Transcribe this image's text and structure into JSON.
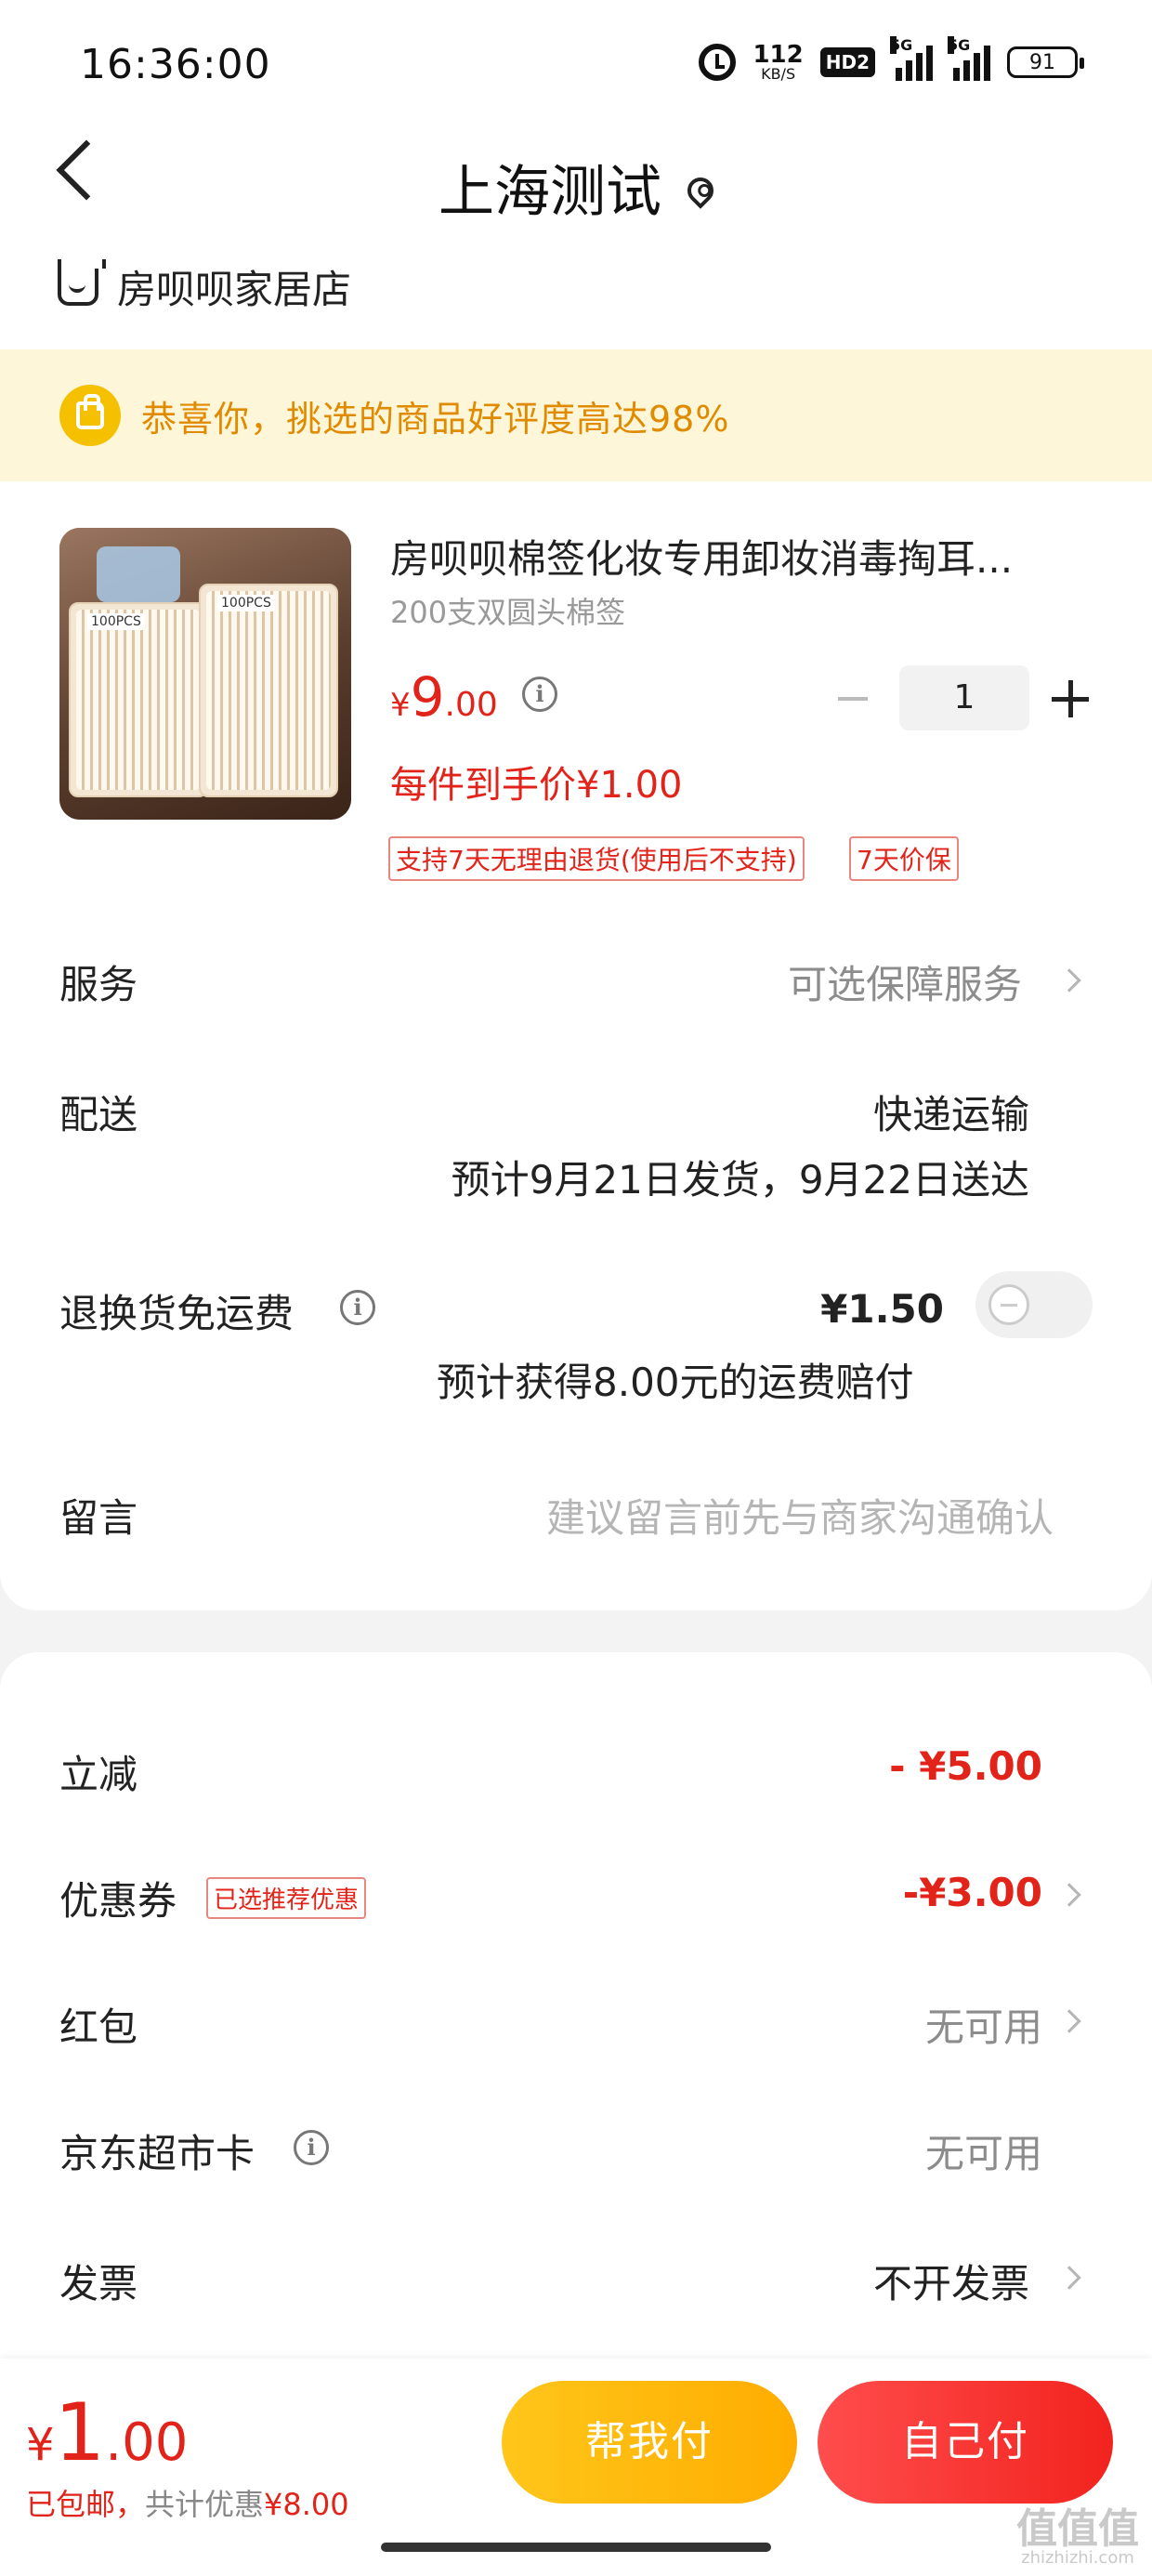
{
  "status_bar": {
    "time": "16:36:00",
    "net_speed_value": "112",
    "net_speed_unit": "KB/S",
    "hd_label": "HD2",
    "signal1_label": "5G",
    "signal2_label": "5G",
    "battery": "91"
  },
  "nav": {
    "title": "上海测试",
    "shop_name": "房呗呗家居店"
  },
  "banner": {
    "text": "恭喜你，挑选的商品好评度高达98%"
  },
  "product": {
    "title": "房呗呗棉签化妆专用卸妆消毒掏耳...",
    "spec": "200支双圆头棉签",
    "price_currency": "¥",
    "price_int": "9",
    "price_dec": ".00",
    "quantity": "1",
    "unit_price": "每件到手价¥1.00",
    "image_labels": [
      "100PCS",
      "100PCS"
    ],
    "tags": [
      "支持7天无理由退货(使用后不支持)",
      "7天价保"
    ]
  },
  "order_rows": {
    "service_label": "服务",
    "service_value": "可选保障服务",
    "delivery_label": "配送",
    "delivery_method": "快递运输",
    "delivery_eta": "预计9月21日发货，9月22日送达",
    "return_label": "退换货免运费",
    "return_price": "¥1.50",
    "return_note": "预计获得8.00元的运费赔付",
    "return_enabled": false,
    "message_label": "留言",
    "message_placeholder": "建议留言前先与商家沟通确认"
  },
  "discounts": {
    "instant_label": "立减",
    "instant_value": "- ¥5.00",
    "coupon_label": "优惠券",
    "coupon_badge": "已选推荐优惠",
    "coupon_value": "-¥3.00",
    "redpacket_label": "红包",
    "redpacket_value": "无可用",
    "card_label": "京东超市卡",
    "card_value": "无可用",
    "invoice_label": "发票",
    "invoice_value": "不开发票"
  },
  "bottom": {
    "total_currency": "¥",
    "total_int": "1",
    "total_dec": ".00",
    "shipping_note": "已包邮，",
    "savings_prefix": "共计优惠",
    "savings_value": "¥8.00",
    "help_pay_label": "帮我付",
    "self_pay_label": "自己付"
  },
  "watermark": {
    "text": "值值值",
    "subtext": "zhizhizhi.com"
  },
  "colors": {
    "accent_red": "#e2231a",
    "banner_bg": "#fdf6d8",
    "banner_text": "#e08a00",
    "help_button": "#ffb600",
    "self_button": "#f2231e"
  }
}
